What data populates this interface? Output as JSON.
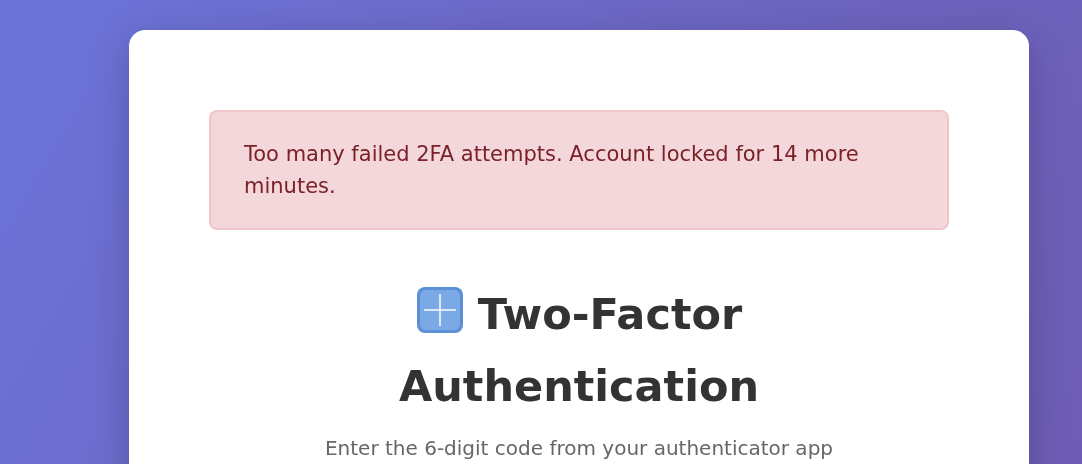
{
  "alert": {
    "message": "Too many failed 2FA attempts. Account locked for 14 more minutes."
  },
  "heading": {
    "title": "Two-Factor Authentication"
  },
  "subtitle": "Enter the 6-digit code from your authenticator app"
}
